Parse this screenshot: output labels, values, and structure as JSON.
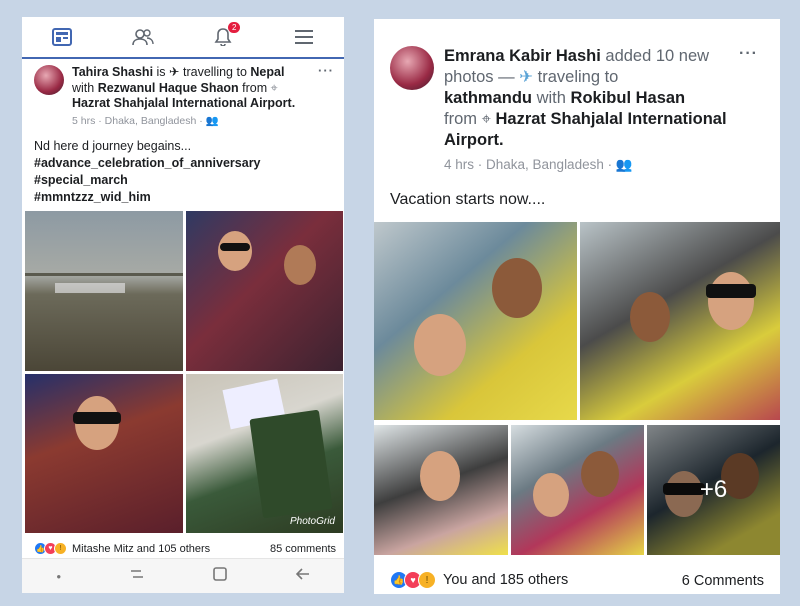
{
  "left": {
    "nav": {
      "notifications_count": "2"
    },
    "post": {
      "author": "Tahira Shashi",
      "is_word": " is ",
      "activity": " travelling to ",
      "destination": "Nepal",
      "with_word": "with ",
      "companion": "Rezwanul Haque Shaon",
      "from_word": " from ",
      "place": "Hazrat Shahjalal International Airport.",
      "meta": "5 hrs · Dhaka, Bangladesh · ",
      "lines": [
        "Nd here d journey begains...",
        "#advance_celebration_of_anniversary",
        "#special_march",
        "#mmntzzz_wid_him"
      ],
      "watermark": "PhotoGrid",
      "reactions_text": "Mitashe Mitz and 105 others",
      "comments": "85 comments"
    }
  },
  "right": {
    "post": {
      "author": "Emrana Kabir Hashi",
      "action": " added 10 new photos — ",
      "activity": " traveling to ",
      "destination": "kathmandu",
      "with_word": " with ",
      "companion": "Rokibul Hasan",
      "from_word": "from ",
      "place": "Hazrat Shahjalal International Airport.",
      "meta": "4 hrs · Dhaka, Bangladesh · ",
      "caption": "Vacation starts now....",
      "more_photos": "+6",
      "reactions_text": "You and 185 others",
      "comments": "6 Comments"
    }
  },
  "colors": {
    "facebook_blue": "#4267b2",
    "badge_red": "#e41e3f"
  }
}
